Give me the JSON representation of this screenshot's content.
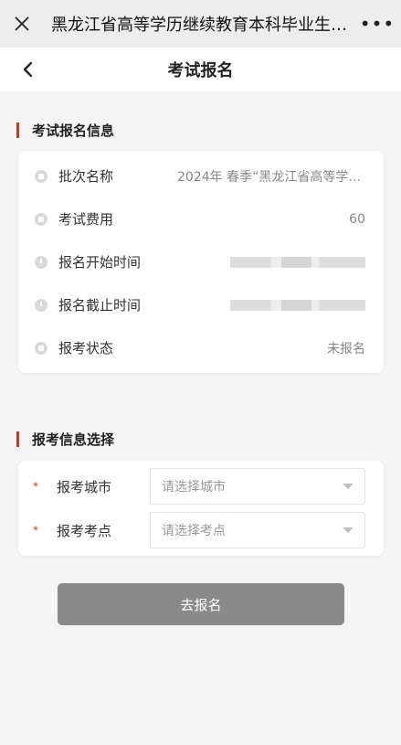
{
  "window": {
    "title": "黑龙江省高等学历继续教育本科毕业生学士学位外语考试",
    "more_label": "•••"
  },
  "navbar": {
    "title": "考试报名"
  },
  "info_section": {
    "title": "考试报名信息",
    "rows": [
      {
        "label": "批次名称",
        "value": "2024年 春季“黑龙江省高等学历继续教育本科毕业生学士学位外语考试”",
        "icon": "doc-icon"
      },
      {
        "label": "考试费用",
        "value": "60",
        "icon": "fee-icon"
      },
      {
        "label": "报名开始时间",
        "value": "",
        "icon": "clock-icon"
      },
      {
        "label": "报名截止时间",
        "value": "",
        "icon": "clock-icon"
      },
      {
        "label": "报考状态",
        "value": "未报名",
        "icon": "status-icon"
      }
    ]
  },
  "select_section": {
    "title": "报考信息选择",
    "rows": [
      {
        "label": "报考城市",
        "placeholder": "请选择城市"
      },
      {
        "label": "报考考点",
        "placeholder": "请选择考点"
      }
    ],
    "required_mark": "*"
  },
  "submit": {
    "label": "去报名"
  },
  "colors": {
    "accent": "#c0392b",
    "button": "#8a8a8a"
  }
}
